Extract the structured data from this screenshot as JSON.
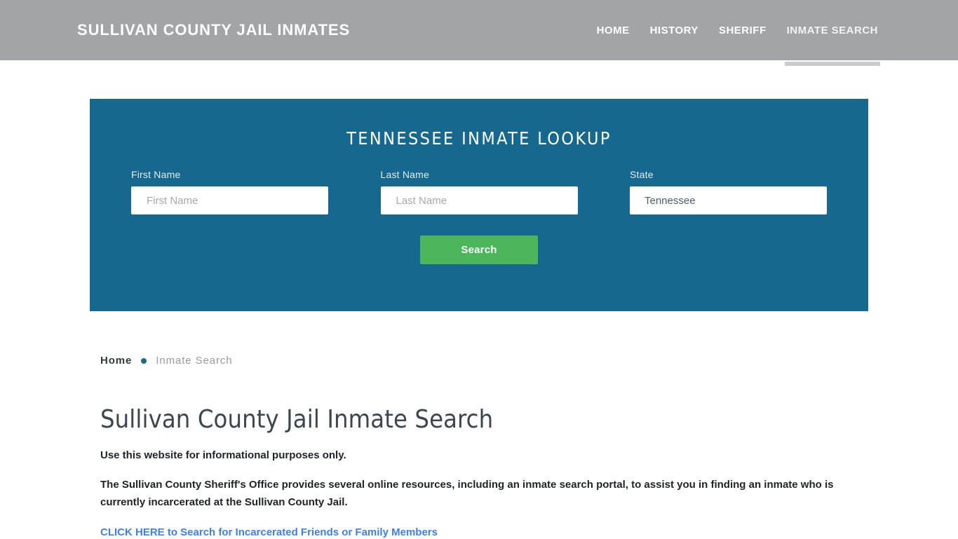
{
  "header": {
    "brand": "Sullivan County Jail Inmates",
    "nav": [
      {
        "label": "Home",
        "active": false
      },
      {
        "label": "History",
        "active": false
      },
      {
        "label": "Sheriff",
        "active": false
      },
      {
        "label": "Inmate Search",
        "active": true
      }
    ]
  },
  "lookup": {
    "title": "Tennessee Inmate Lookup",
    "first_name": {
      "label": "First Name",
      "placeholder": "First Name",
      "value": ""
    },
    "last_name": {
      "label": "Last Name",
      "placeholder": "Last Name",
      "value": ""
    },
    "state": {
      "label": "State",
      "value": "Tennessee"
    },
    "submit_label": "Search"
  },
  "breadcrumb": {
    "home": "Home",
    "current": "Inmate Search"
  },
  "content": {
    "title": "Sullivan County Jail Inmate Search",
    "note": "Use this website for informational purposes only.",
    "paragraph": "The Sullivan County Sheriff's Office provides several online resources, including an inmate search portal, to assist you in finding an inmate who is currently incarcerated at the Sullivan County Jail.",
    "cta": "CLICK HERE to Search for Incarcerated Friends or Family Members"
  },
  "colors": {
    "header_bg": "#a1a5a8",
    "panel_bg": "#16688f",
    "button_green": "#4cb75a",
    "link_blue": "#3d7ff0",
    "accent_dot": "#16688f"
  }
}
